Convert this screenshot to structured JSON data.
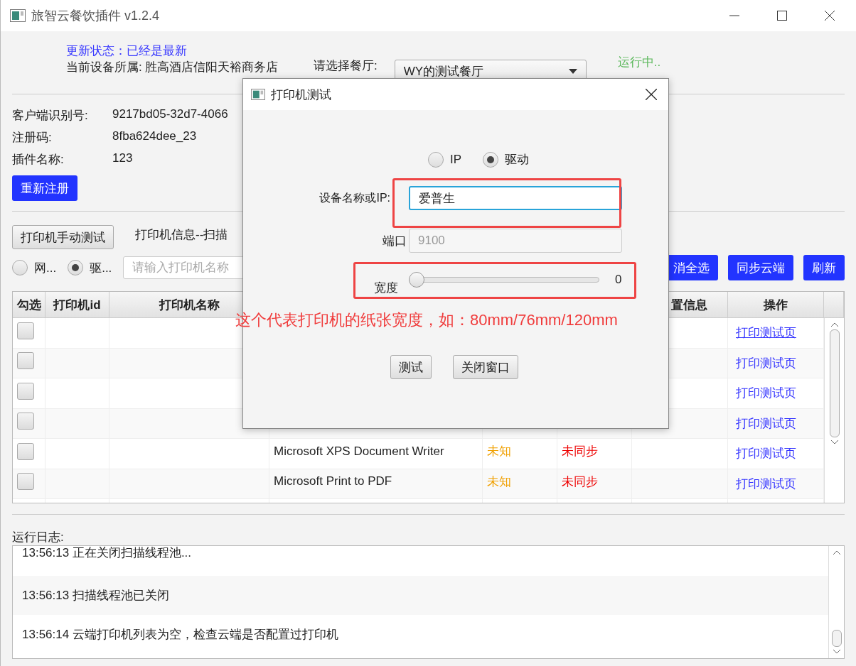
{
  "window": {
    "title": "旅智云餐饮插件 v1.2.4"
  },
  "header": {
    "update_status": "更新状态：已经是最新",
    "device_owner": "当前设备所属: 胜高酒店信阳天裕商务店",
    "restaurant_label": "请选择餐厅:",
    "restaurant_select": "WY的测试餐厅",
    "run_status": "运行中.."
  },
  "info": [
    {
      "label": "客户端识别号:",
      "value": "9217bd05-32d7-4066"
    },
    {
      "label": "注册码:",
      "value": "8fba624dee_23"
    },
    {
      "label": "插件名称:",
      "value": "123"
    }
  ],
  "reregister_button": "重新注册",
  "printer_section": {
    "manual_test_button": "打印机手动测试",
    "info_label": "打印机信息--扫描",
    "modes": [
      {
        "label": "网...",
        "selected": false
      },
      {
        "label": "驱...",
        "selected": true
      }
    ],
    "search": {
      "placeholder": "请输入打印机名称"
    },
    "buttons": [
      "消全选",
      "同步云端",
      "刷新"
    ]
  },
  "table": {
    "columns": [
      {
        "label": "勾选"
      },
      {
        "label": "打印机id"
      },
      {
        "label": "打印机名称"
      },
      {
        "label": "置信息"
      },
      {
        "label": "操作"
      }
    ],
    "rows": [
      {
        "checked": false,
        "action": "打印测试页",
        "hovered": true
      },
      {
        "checked": false,
        "action": "打印测试页",
        "hovered": false
      },
      {
        "checked": false,
        "action": "打印测试页",
        "hovered": false
      },
      {
        "checked": false,
        "action": "打印测试页",
        "hovered": false
      },
      {
        "checked": false,
        "column_4": "Microsoft XPS Document Writer",
        "column_5": "未知",
        "column_6": "未同步",
        "action": "打印测试页",
        "hovered": false
      },
      {
        "checked": false,
        "column_4": "Microsoft Print to PDF",
        "column_5": "未知",
        "column_6": "未同步",
        "action": "打印测试页",
        "hovered": false
      }
    ]
  },
  "log": {
    "label": "运行日志:",
    "entries": [
      "13:56:13 正在关闭扫描线程池...",
      "13:56:13 扫描线程池已关闭",
      "13:56:14 云端打印机列表为空，检查云端是否配置过打印机"
    ]
  },
  "dialog": {
    "title": "打印机测试",
    "modes": [
      {
        "label": "IP",
        "selected": false
      },
      {
        "label": "驱动",
        "selected": true
      }
    ],
    "device_label": "设备名称或IP:",
    "device_value": "爱普生",
    "port_label": "端口",
    "port_value": "9100",
    "port_disabled": true,
    "width_label": "宽度",
    "width_slider": {
      "level": 0
    },
    "width_reading": "0",
    "buttons": [
      "测试",
      "关闭窗口"
    ]
  },
  "annotation": {
    "note": "这个代表打印机的纸张宽度，如：80mm/76mm/120mm"
  }
}
